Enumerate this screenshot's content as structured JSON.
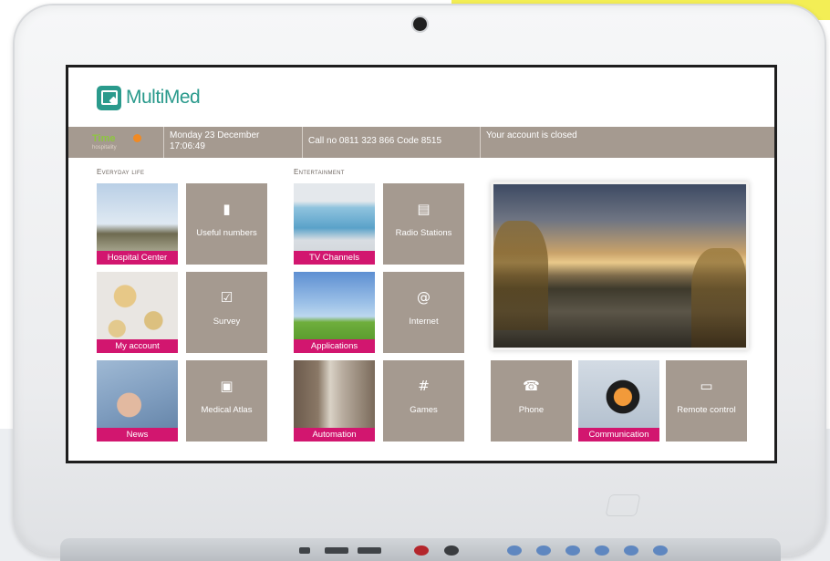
{
  "app": {
    "name": "MultiMed"
  },
  "status_bar": {
    "brand_main": "Time",
    "brand_sub": "hospitality",
    "datetime_line1": "Monday 23 December",
    "datetime_line2": "17:06:49",
    "call_info": "Call no 0811 323 866 Code 8515",
    "account_status": "Your account is closed"
  },
  "sections": {
    "everyday_life": "Everyday life",
    "entertainment": "Entertainment"
  },
  "tiles": {
    "hospital_center": "Hospital Center",
    "useful_numbers": "Useful numbers",
    "my_account": "My account",
    "survey": "Survey",
    "news": "News",
    "medical_atlas": "Medical Atlas",
    "tv_channels": "TV Channels",
    "radio_stations": "Radio Stations",
    "applications": "Applications",
    "internet": "Internet",
    "automation": "Automation",
    "games": "Games",
    "phone": "Phone",
    "communication": "Communication",
    "remote_control": "Remote control"
  },
  "icons": {
    "useful_numbers": "address-book-icon",
    "survey": "checkbox-icon",
    "medical_atlas": "medical-book-icon",
    "radio_stations": "radio-icon",
    "internet": "at-sign-icon",
    "games": "hashtag-grid-icon",
    "phone": "telephone-icon",
    "remote_control": "tv-icon"
  },
  "colors": {
    "tile_bg": "#a59a90",
    "accent_magenta": "#d2166f",
    "logo_teal": "#2a9a8c",
    "brand_green": "#8dc63f"
  }
}
